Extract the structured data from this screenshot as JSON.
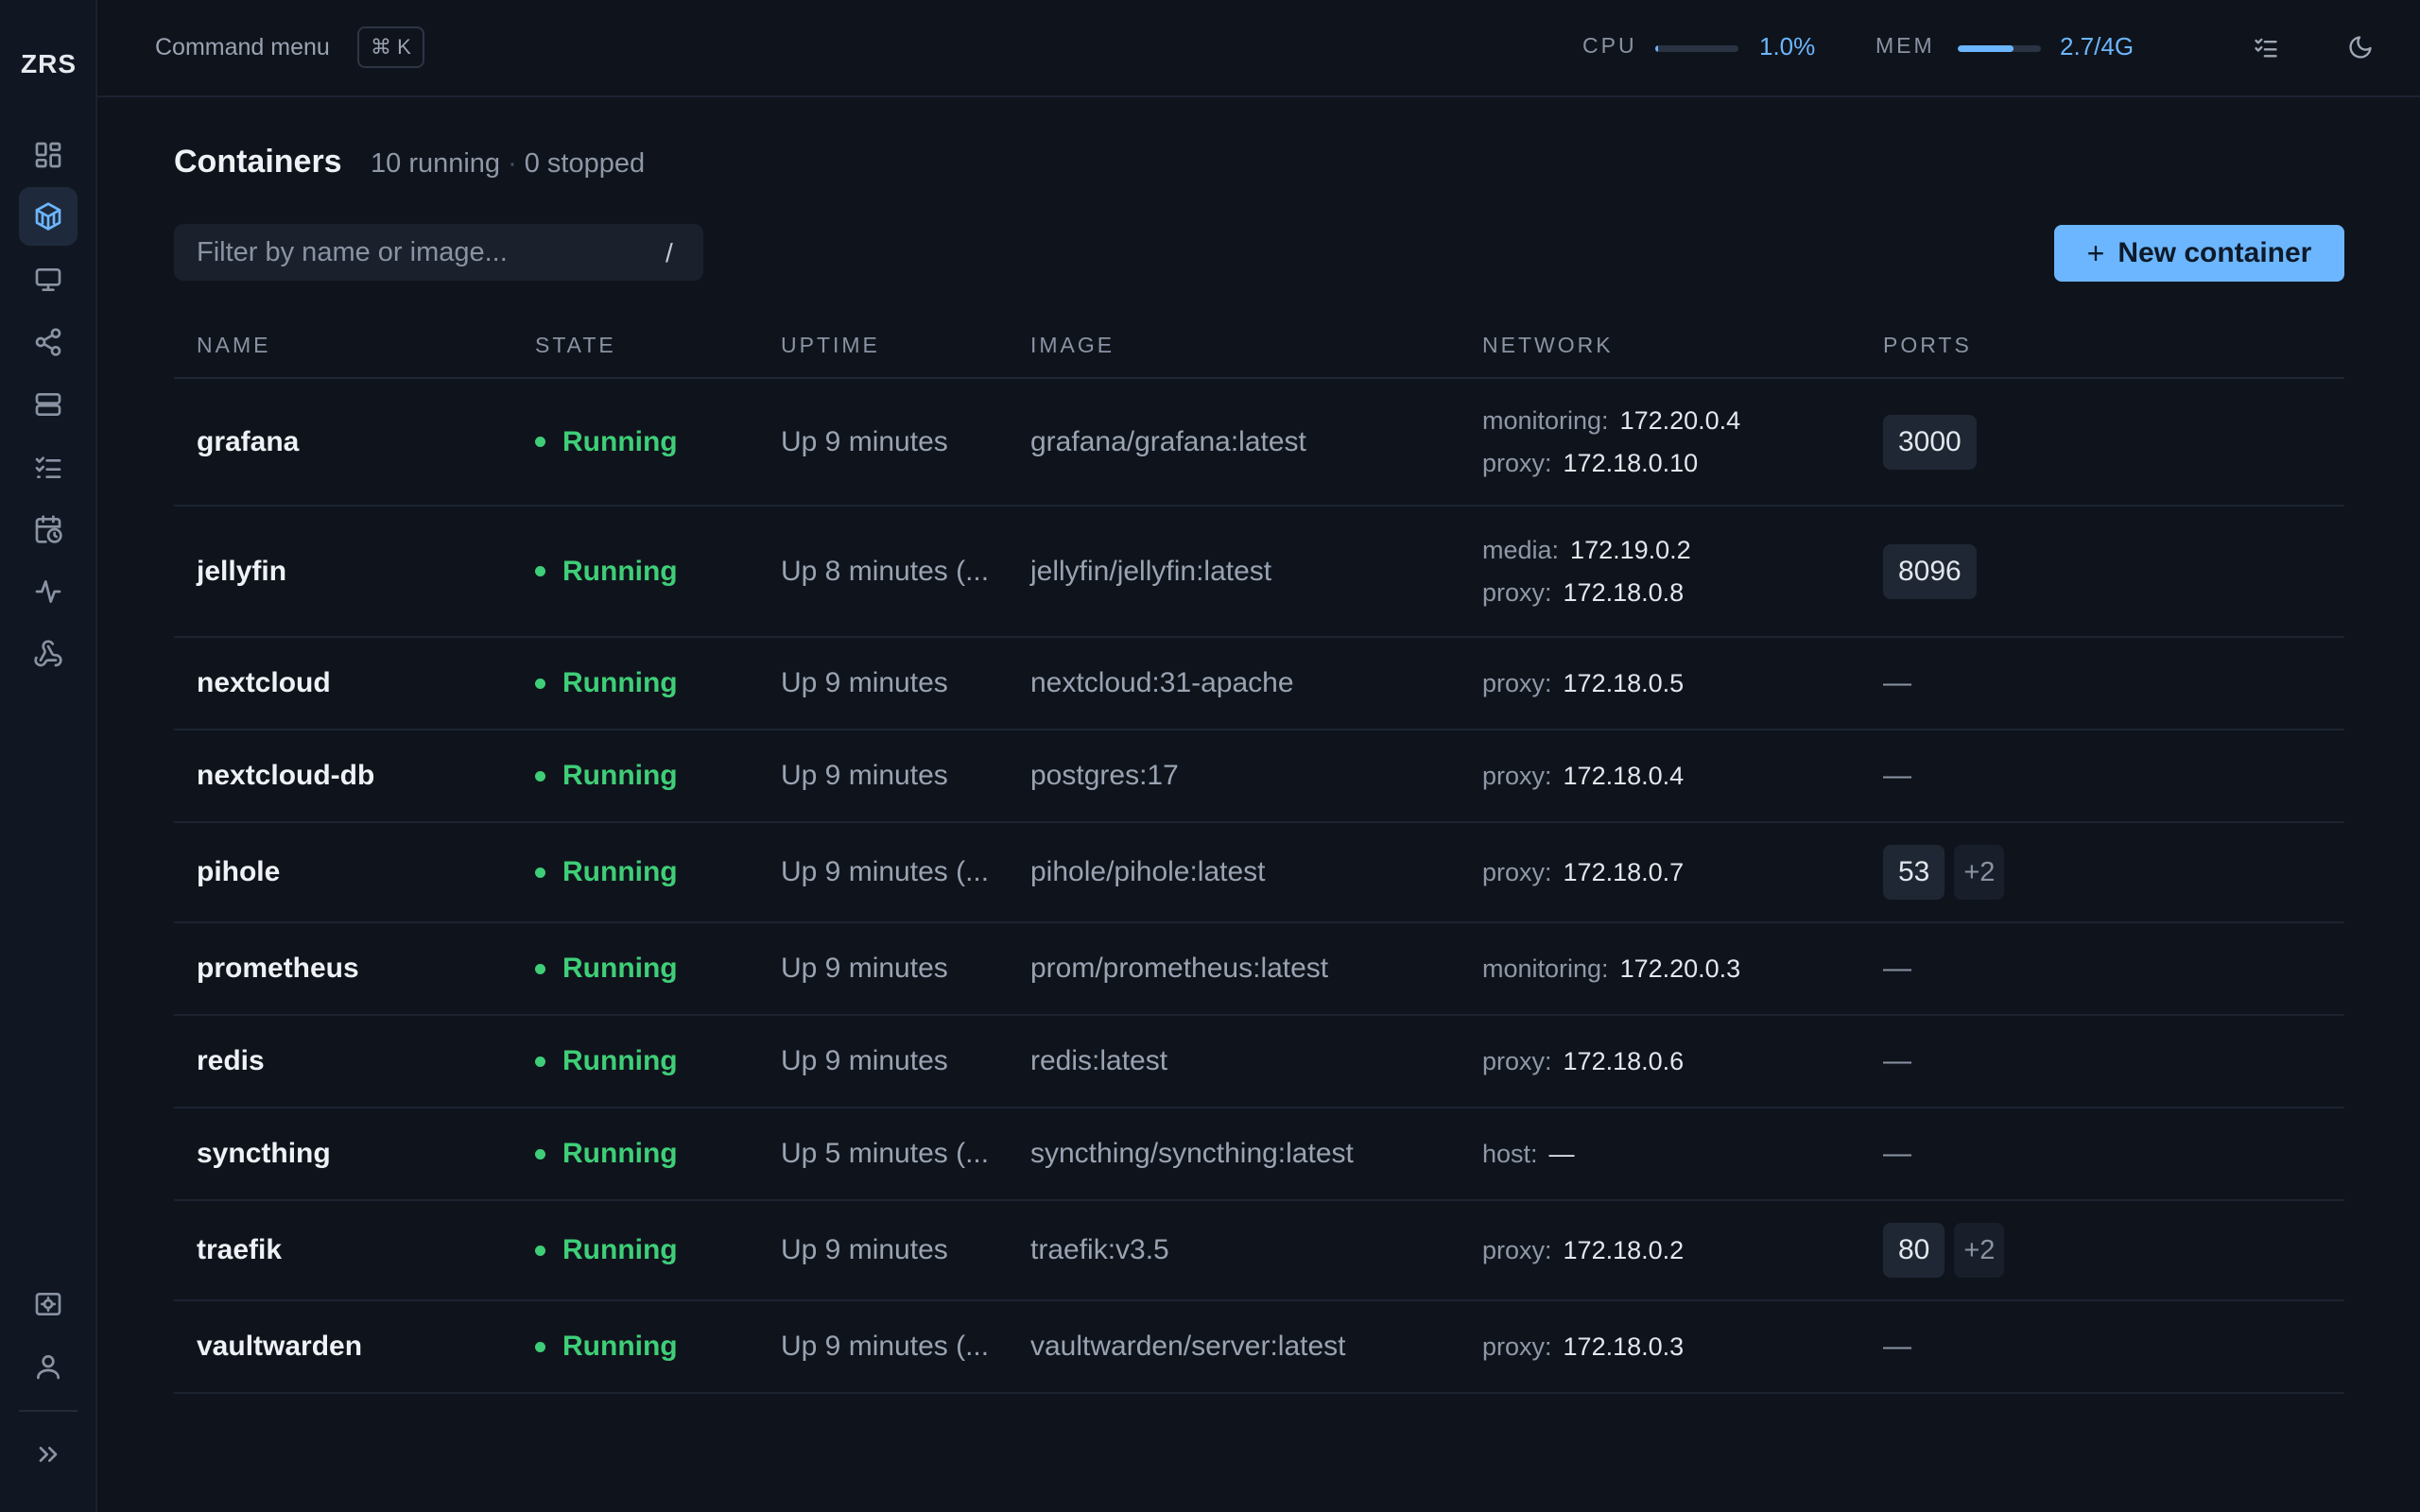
{
  "app": {
    "logo": "ZRS"
  },
  "topbar": {
    "command_label": "Command menu",
    "command_shortcut": "⌘ K",
    "cpu": {
      "label": "CPU",
      "value": "1.0%",
      "fraction": 0.01
    },
    "mem": {
      "label": "MEM",
      "value": "2.7/4G",
      "fraction": 0.675
    }
  },
  "sidebar": {
    "items": [
      {
        "name": "dashboard",
        "icon": "dashboard-icon",
        "active": false
      },
      {
        "name": "containers",
        "icon": "container-icon",
        "active": true
      },
      {
        "name": "hosts",
        "icon": "monitor-icon",
        "active": false
      },
      {
        "name": "networks",
        "icon": "share-icon",
        "active": false
      },
      {
        "name": "storage",
        "icon": "server-icon",
        "active": false
      },
      {
        "name": "tasks",
        "icon": "list-check-icon",
        "active": false
      },
      {
        "name": "schedules",
        "icon": "calendar-clock-icon",
        "active": false
      },
      {
        "name": "activity",
        "icon": "activity-icon",
        "active": false
      },
      {
        "name": "webhooks",
        "icon": "webhook-icon",
        "active": false
      }
    ],
    "bottom_items": [
      {
        "name": "settings",
        "icon": "settings-icon"
      },
      {
        "name": "account",
        "icon": "user-icon"
      },
      {
        "name": "expand",
        "icon": "chevrons-right-icon"
      }
    ]
  },
  "main": {
    "title": "Containers",
    "running": "10 running",
    "stopped": "0 stopped",
    "filter_placeholder": "Filter by name or image...",
    "filter_shortcut": "/",
    "new_button": "New container",
    "columns": [
      "NAME",
      "STATE",
      "UPTIME",
      "IMAGE",
      "NETWORK",
      "PORTS"
    ],
    "rows": [
      {
        "name": "grafana",
        "state": "Running",
        "uptime": "Up 9 minutes",
        "image": "grafana/grafana:latest",
        "networks": [
          {
            "name": "monitoring:",
            "ip": "172.20.0.4"
          },
          {
            "name": "proxy:",
            "ip": "172.18.0.10"
          }
        ],
        "ports": [
          "3000"
        ],
        "more_ports": ""
      },
      {
        "name": "jellyfin",
        "state": "Running",
        "uptime": "Up 8 minutes (...",
        "image": "jellyfin/jellyfin:latest",
        "networks": [
          {
            "name": "media:",
            "ip": "172.19.0.2"
          },
          {
            "name": "proxy:",
            "ip": "172.18.0.8"
          }
        ],
        "ports": [
          "8096"
        ],
        "more_ports": ""
      },
      {
        "name": "nextcloud",
        "state": "Running",
        "uptime": "Up 9 minutes",
        "image": "nextcloud:31-apache",
        "networks": [
          {
            "name": "proxy:",
            "ip": "172.18.0.5"
          }
        ],
        "ports": [],
        "more_ports": ""
      },
      {
        "name": "nextcloud-db",
        "state": "Running",
        "uptime": "Up 9 minutes",
        "image": "postgres:17",
        "networks": [
          {
            "name": "proxy:",
            "ip": "172.18.0.4"
          }
        ],
        "ports": [],
        "more_ports": ""
      },
      {
        "name": "pihole",
        "state": "Running",
        "uptime": "Up 9 minutes (...",
        "image": "pihole/pihole:latest",
        "networks": [
          {
            "name": "proxy:",
            "ip": "172.18.0.7"
          }
        ],
        "ports": [
          "53"
        ],
        "more_ports": "+2"
      },
      {
        "name": "prometheus",
        "state": "Running",
        "uptime": "Up 9 minutes",
        "image": "prom/prometheus:latest",
        "networks": [
          {
            "name": "monitoring:",
            "ip": "172.20.0.3"
          }
        ],
        "ports": [],
        "more_ports": ""
      },
      {
        "name": "redis",
        "state": "Running",
        "uptime": "Up 9 minutes",
        "image": "redis:latest",
        "networks": [
          {
            "name": "proxy:",
            "ip": "172.18.0.6"
          }
        ],
        "ports": [],
        "more_ports": ""
      },
      {
        "name": "syncthing",
        "state": "Running",
        "uptime": "Up 5 minutes (...",
        "image": "syncthing/syncthing:latest",
        "networks": [
          {
            "name": "host:",
            "ip": "—"
          }
        ],
        "ports": [],
        "more_ports": ""
      },
      {
        "name": "traefik",
        "state": "Running",
        "uptime": "Up 9 minutes",
        "image": "traefik:v3.5",
        "networks": [
          {
            "name": "proxy:",
            "ip": "172.18.0.2"
          }
        ],
        "ports": [
          "80"
        ],
        "more_ports": "+2"
      },
      {
        "name": "vaultwarden",
        "state": "Running",
        "uptime": "Up 9 minutes (...",
        "image": "vaultwarden/server:latest",
        "networks": [
          {
            "name": "proxy:",
            "ip": "172.18.0.3"
          }
        ],
        "ports": [],
        "more_ports": ""
      }
    ],
    "empty_value": "—"
  },
  "colors": {
    "accent": "#6cb6ff",
    "running": "#3fce78",
    "background": "#0f141c"
  }
}
